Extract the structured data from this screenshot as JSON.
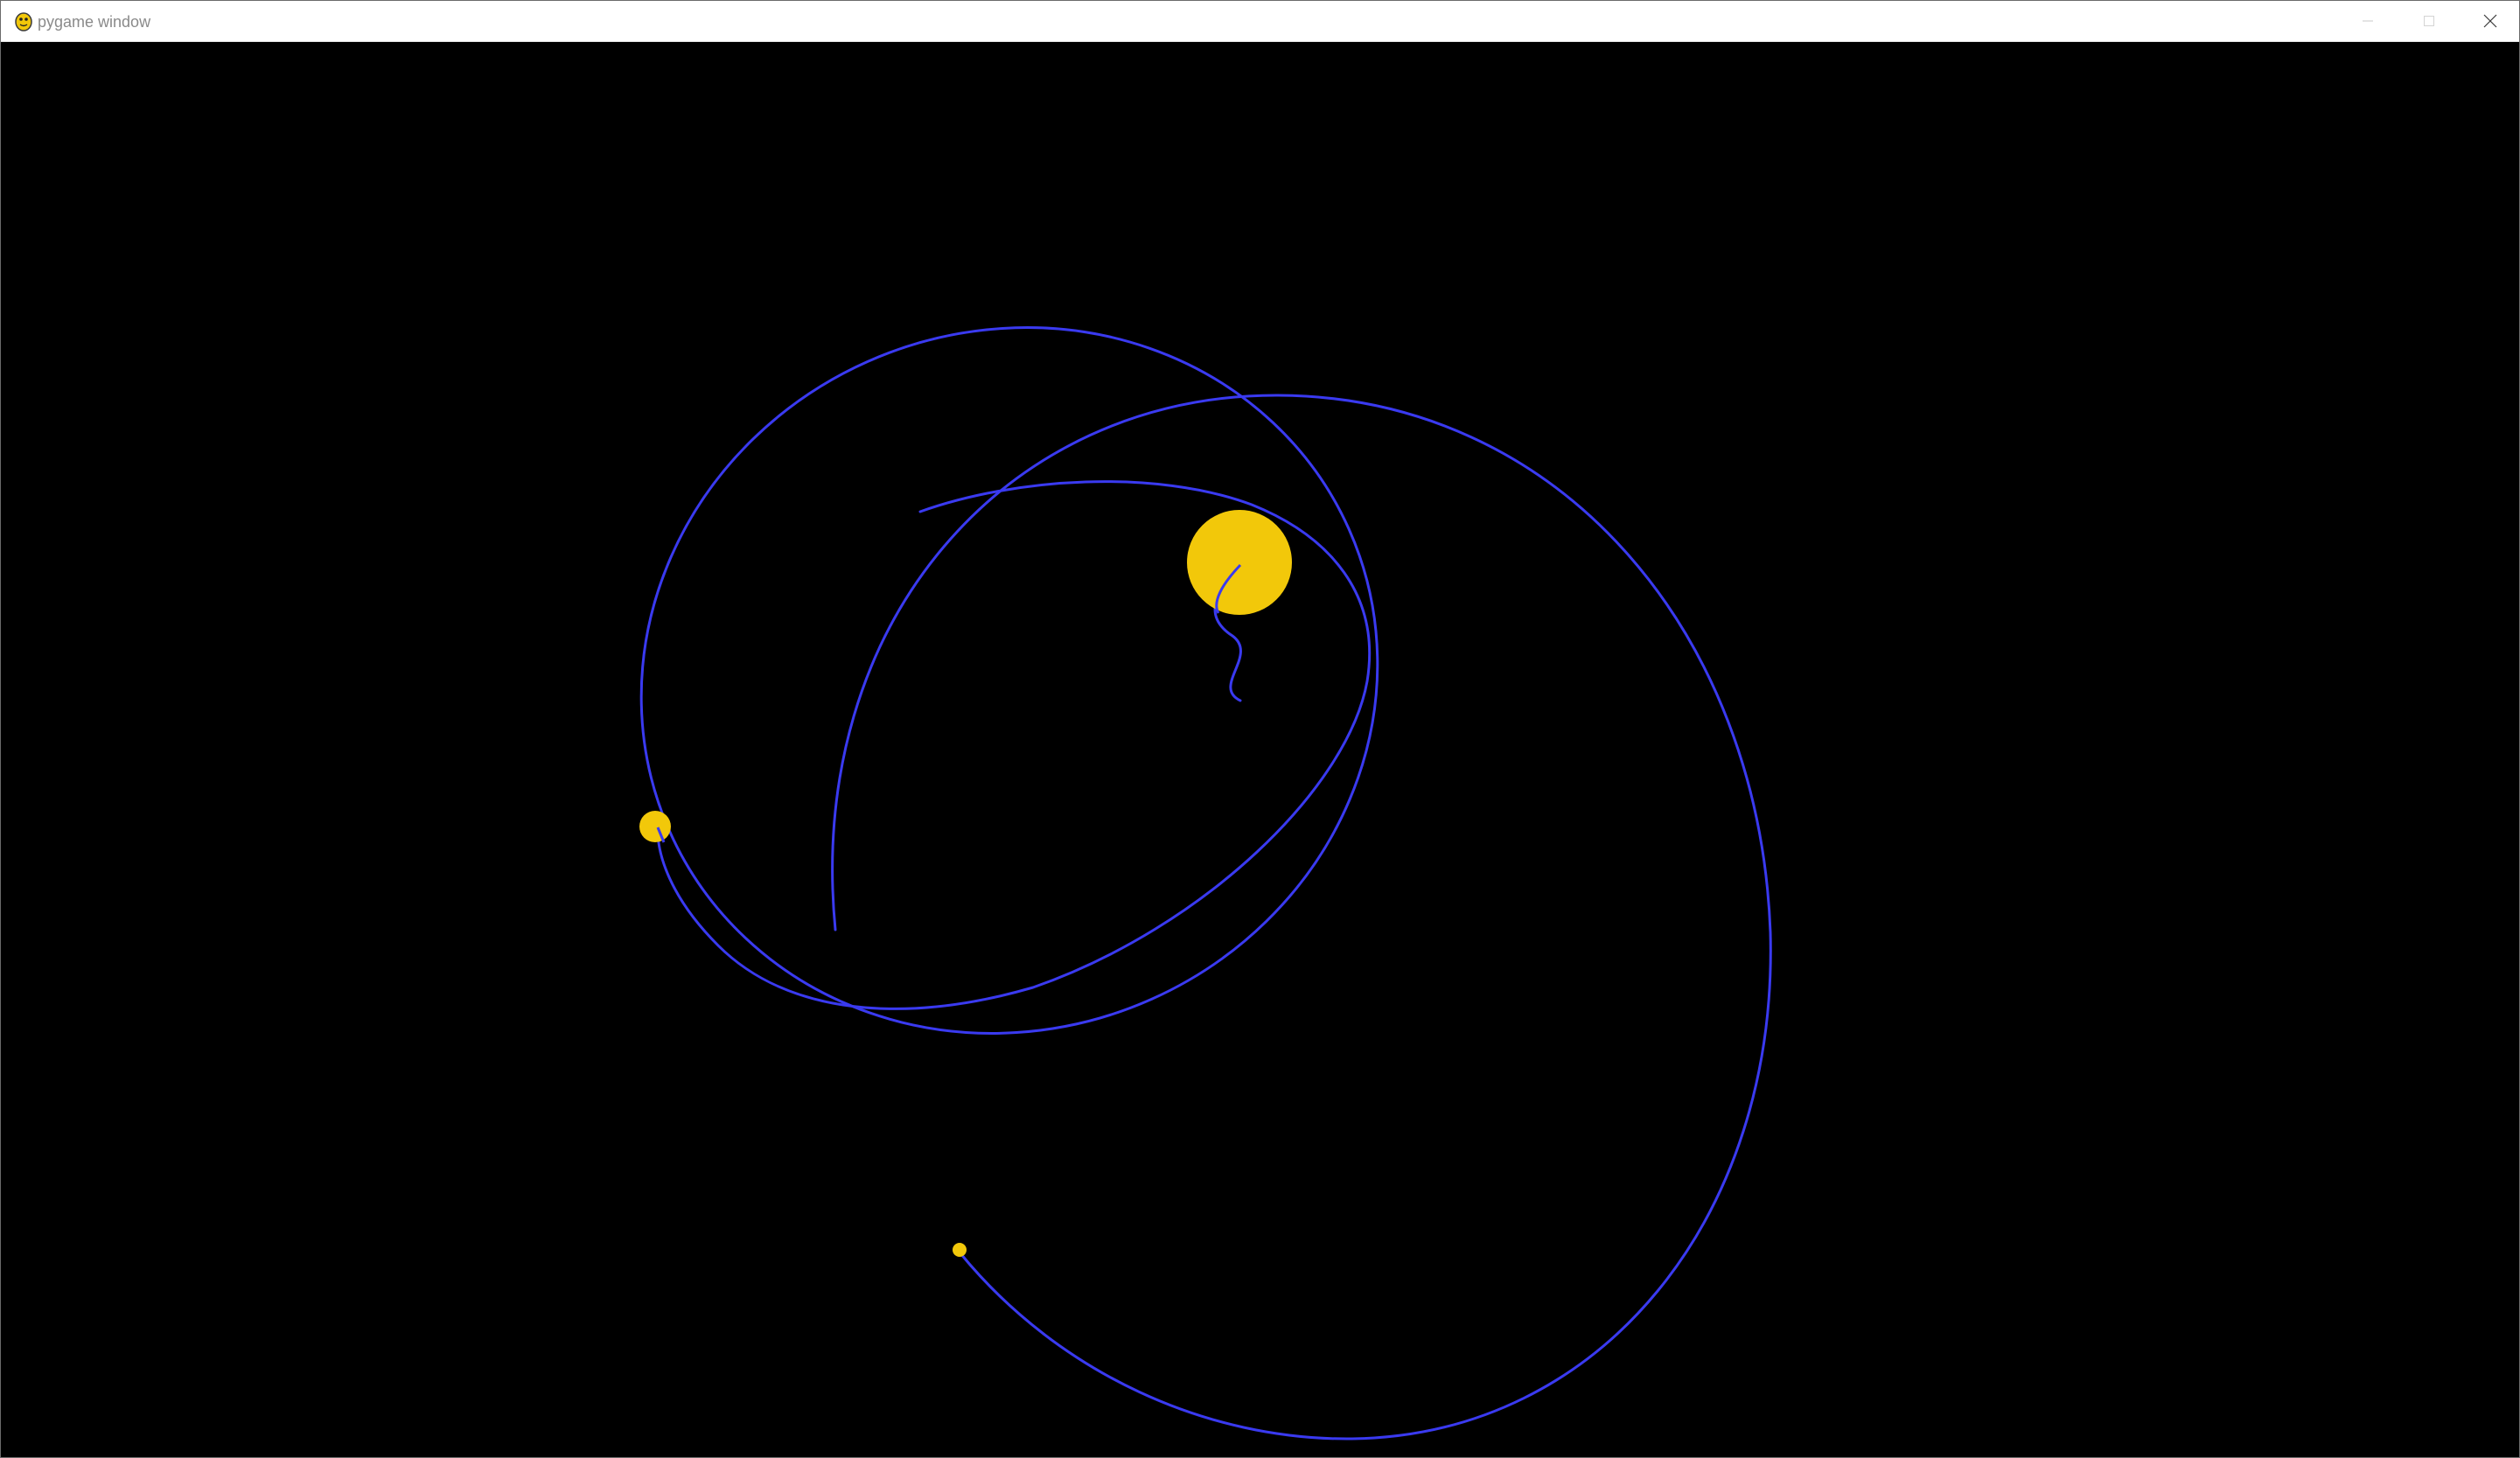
{
  "window": {
    "title": "pygame window",
    "icon": "pygame-snake-icon",
    "controls": [
      "minimize-icon",
      "maximize-icon",
      "close-icon"
    ]
  },
  "scene": {
    "background_color": "#000000",
    "trail_color": "#3a3af0",
    "body_color": "#f2c80a",
    "bodies": [
      "large-sun-body",
      "medium-planet-body",
      "small-planet-body"
    ],
    "trails": [
      "outer-orbit-trail",
      "inner-orbit-trail",
      "large-loop-trail",
      "small-wiggle-trail"
    ]
  }
}
